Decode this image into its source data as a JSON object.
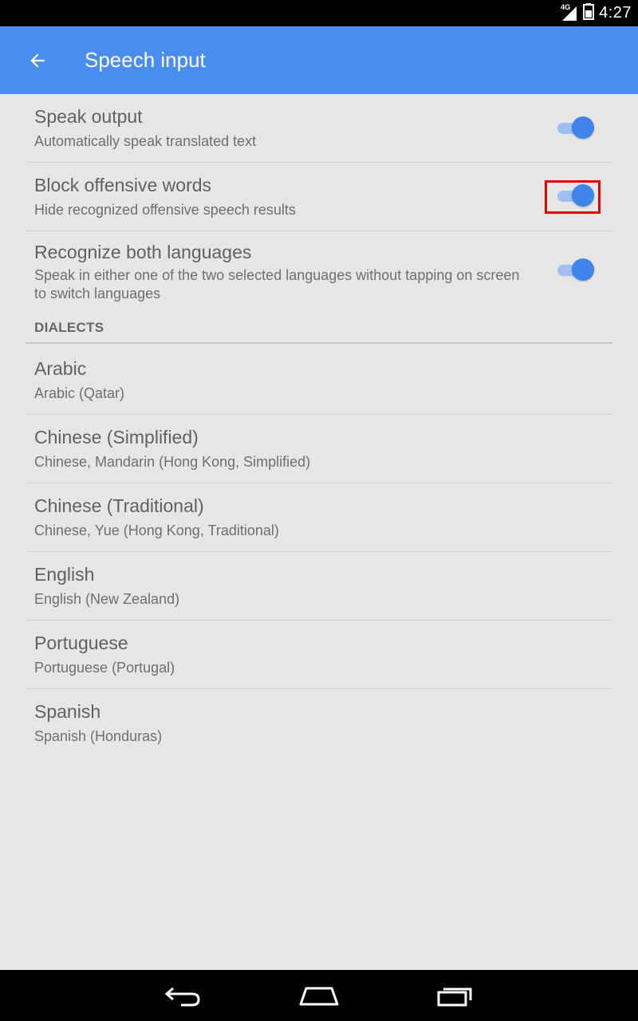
{
  "status_bar": {
    "network": "4G",
    "time": "4:27",
    "icons": [
      "signal-icon",
      "battery-icon"
    ]
  },
  "app_bar": {
    "title": "Speech input",
    "back_icon": "arrow-back-icon"
  },
  "settings": [
    {
      "title": "Speak output",
      "subtitle": "Automatically speak translated text",
      "enabled": true
    },
    {
      "title": "Block offensive words",
      "subtitle": "Hide recognized offensive speech results",
      "enabled": true
    },
    {
      "title": "Recognize both languages",
      "subtitle": "Speak in either one of the two selected languages without tapping on screen to switch languages",
      "enabled": true
    }
  ],
  "dialects": {
    "header": "DIALECTS",
    "items": [
      {
        "title": "Arabic",
        "subtitle": "Arabic (Qatar)"
      },
      {
        "title": "Chinese (Simplified)",
        "subtitle": "Chinese, Mandarin (Hong Kong, Simplified)"
      },
      {
        "title": "Chinese (Traditional)",
        "subtitle": "Chinese, Yue (Hong Kong, Traditional)"
      },
      {
        "title": "English",
        "subtitle": "English (New Zealand)"
      },
      {
        "title": "Portuguese",
        "subtitle": "Portuguese (Portugal)"
      },
      {
        "title": "Spanish",
        "subtitle": "Spanish (Honduras)"
      }
    ]
  },
  "nav_bar": {
    "icons": [
      "back-nav-icon",
      "home-nav-icon",
      "recents-nav-icon"
    ]
  },
  "colors": {
    "app_bar": "#4a8df0",
    "switch_on": "#3f84ea",
    "highlight": "#e00000"
  }
}
